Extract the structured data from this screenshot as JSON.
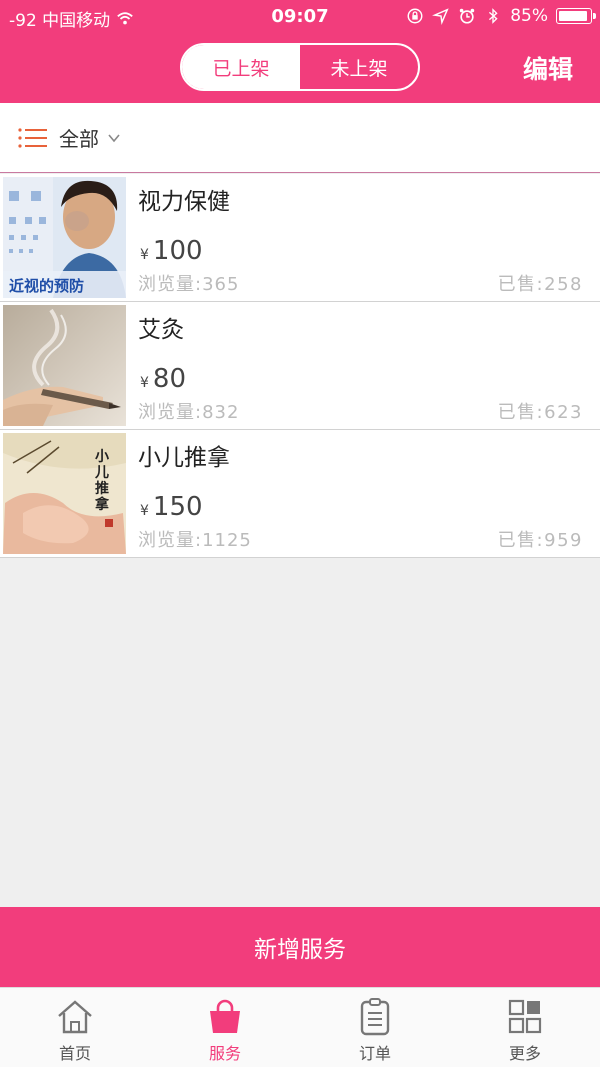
{
  "status_bar": {
    "carrier": "-92 中国移动",
    "time": "09:07",
    "battery": "85%",
    "battery_level": 0.85
  },
  "header": {
    "tabs": [
      {
        "label": "已上架",
        "active": true
      },
      {
        "label": "未上架",
        "active": false
      }
    ],
    "edit_label": "编辑"
  },
  "filter": {
    "label": "全部",
    "icon": "list-icon"
  },
  "services": [
    {
      "title": "视力保健",
      "currency": "¥",
      "price": "100",
      "views_label": "浏览量:",
      "views": "365",
      "sold_label": "已售:",
      "sold": "258",
      "thumb_caption": "近视的预防"
    },
    {
      "title": "艾灸",
      "currency": "¥",
      "price": "80",
      "views_label": "浏览量:",
      "views": "832",
      "sold_label": "已售:",
      "sold": "623"
    },
    {
      "title": "小儿推拿",
      "currency": "¥",
      "price": "150",
      "views_label": "浏览量:",
      "views": "1125",
      "sold_label": "已售:",
      "sold": "959",
      "thumb_caption": "小儿推拿"
    }
  ],
  "add_button": "新增服务",
  "tabbar": [
    {
      "label": "首页",
      "icon": "home-icon",
      "active": false
    },
    {
      "label": "服务",
      "icon": "bag-icon",
      "active": true
    },
    {
      "label": "订单",
      "icon": "clipboard-icon",
      "active": false
    },
    {
      "label": "更多",
      "icon": "grid-icon",
      "active": false
    }
  ],
  "colors": {
    "accent": "#f23d7c",
    "filter_icon": "#e8623a",
    "muted_text": "#bbbbbb",
    "background": "#efefef"
  }
}
